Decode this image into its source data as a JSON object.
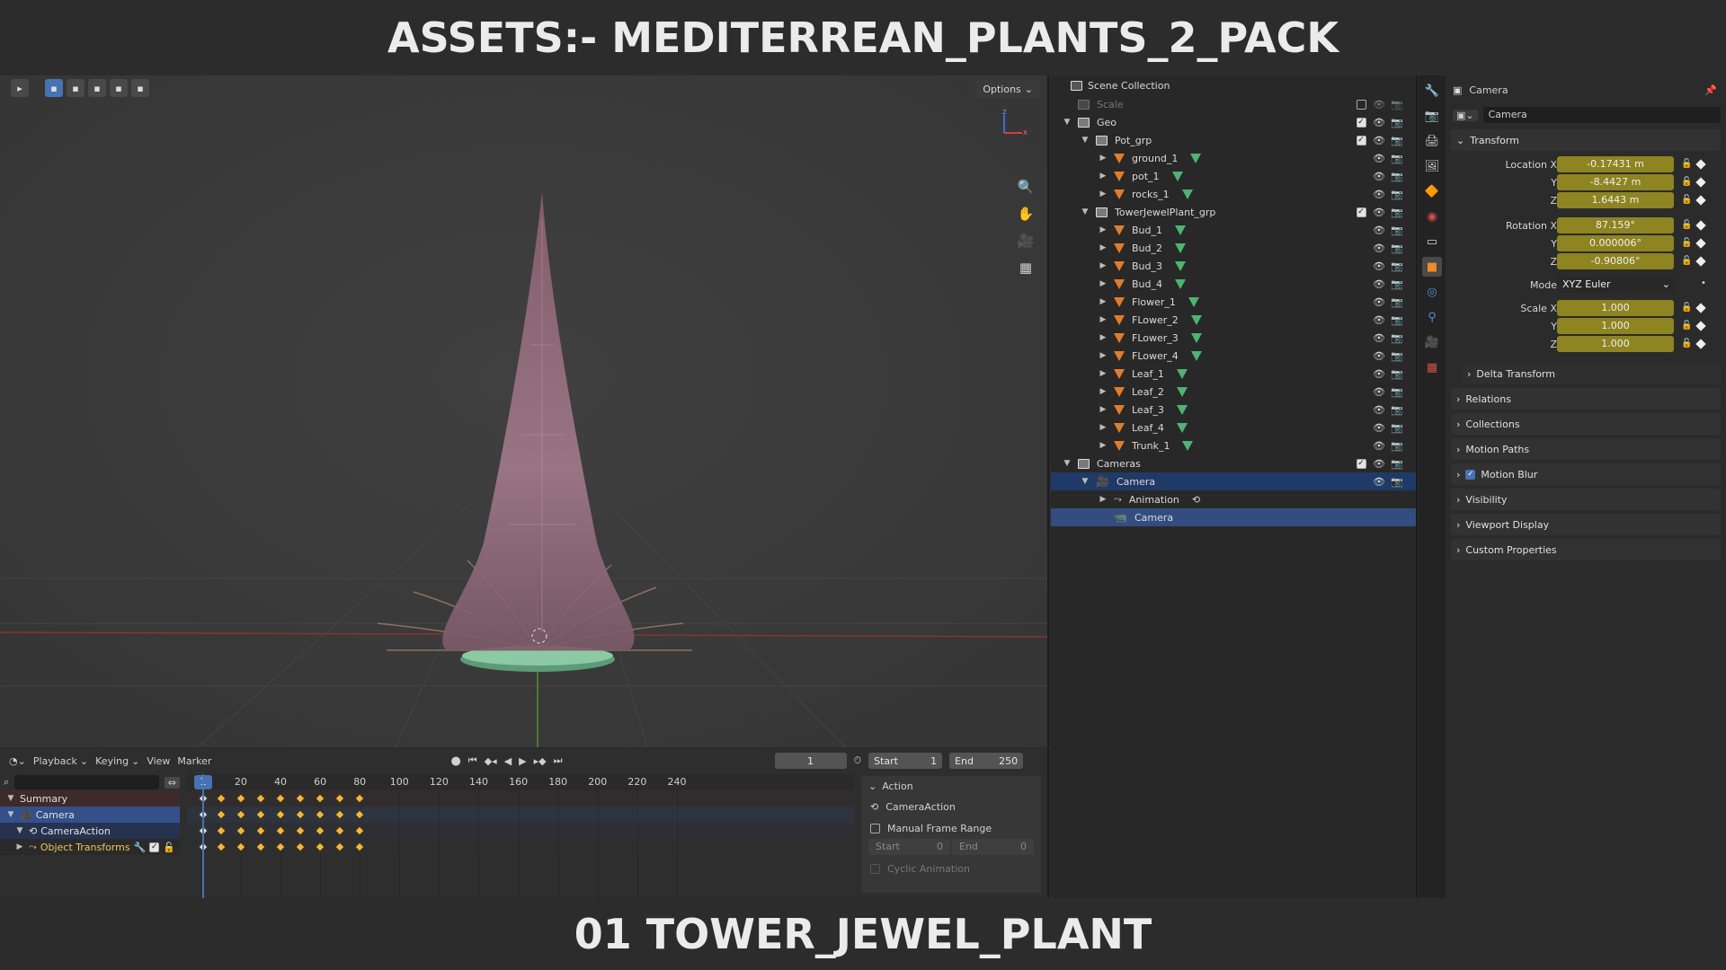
{
  "banner": {
    "top": "ASSETS:- MEDITERREAN_PLANTS_2_PACK",
    "bottom": "01 TOWER_JEWEL_PLANT"
  },
  "viewport": {
    "options_label": "Options",
    "nav_icons": [
      "zoom-icon",
      "pan-hand-icon",
      "camera-view-icon",
      "ortho-grid-icon"
    ]
  },
  "timeline": {
    "menus": [
      "Playback",
      "Keying",
      "View",
      "Marker"
    ],
    "current_frame": "1",
    "start_label": "Start",
    "start_value": "1",
    "end_label": "End",
    "end_value": "250",
    "ruler_ticks": [
      "20",
      "40",
      "60",
      "80",
      "100",
      "120",
      "140",
      "160",
      "180",
      "200",
      "220",
      "240"
    ],
    "ruler_current": "1",
    "channels": [
      "Summary",
      "Camera",
      "CameraAction",
      "Object Transforms"
    ],
    "keyframe_frames": [
      10,
      20,
      30,
      40,
      50,
      60,
      70,
      80
    ],
    "action_panel": {
      "title": "Action",
      "action_name": "CameraAction",
      "manual_range_label": "Manual Frame Range",
      "start_label": "Start",
      "start_value": "0",
      "end_label": "End",
      "end_value": "0",
      "cyclic_label": "Cyclic Animation"
    }
  },
  "outliner": {
    "root": "Scene Collection",
    "rows": [
      {
        "label": "Scale",
        "depth": 0,
        "kind": "collection",
        "dim": true,
        "check": false,
        "expanded": null
      },
      {
        "label": "Geo",
        "depth": 0,
        "kind": "collection",
        "check": true,
        "expanded": true
      },
      {
        "label": "Pot_grp",
        "depth": 1,
        "kind": "collection",
        "check": true,
        "expanded": true
      },
      {
        "label": "ground_1",
        "depth": 2,
        "kind": "mesh",
        "expanded": false
      },
      {
        "label": "pot_1",
        "depth": 2,
        "kind": "mesh",
        "expanded": false
      },
      {
        "label": "rocks_1",
        "depth": 2,
        "kind": "mesh",
        "expanded": false
      },
      {
        "label": "TowerJewelPlant_grp",
        "depth": 1,
        "kind": "collection",
        "check": true,
        "expanded": true
      },
      {
        "label": "Bud_1",
        "depth": 2,
        "kind": "mesh",
        "expanded": false
      },
      {
        "label": "Bud_2",
        "depth": 2,
        "kind": "mesh",
        "expanded": false
      },
      {
        "label": "Bud_3",
        "depth": 2,
        "kind": "mesh",
        "expanded": false
      },
      {
        "label": "Bud_4",
        "depth": 2,
        "kind": "mesh",
        "expanded": false
      },
      {
        "label": "Flower_1",
        "depth": 2,
        "kind": "mesh",
        "expanded": false
      },
      {
        "label": "FLower_2",
        "depth": 2,
        "kind": "mesh",
        "expanded": false
      },
      {
        "label": "FLower_3",
        "depth": 2,
        "kind": "mesh",
        "expanded": false
      },
      {
        "label": "FLower_4",
        "depth": 2,
        "kind": "mesh",
        "expanded": false
      },
      {
        "label": "Leaf_1",
        "depth": 2,
        "kind": "mesh",
        "expanded": false
      },
      {
        "label": "Leaf_2",
        "depth": 2,
        "kind": "mesh",
        "expanded": false
      },
      {
        "label": "Leaf_3",
        "depth": 2,
        "kind": "mesh",
        "expanded": false
      },
      {
        "label": "Leaf_4",
        "depth": 2,
        "kind": "mesh",
        "expanded": false
      },
      {
        "label": "Trunk_1",
        "depth": 2,
        "kind": "mesh",
        "expanded": false
      },
      {
        "label": "Cameras",
        "depth": 0,
        "kind": "collection",
        "check": true,
        "expanded": true
      },
      {
        "label": "Camera",
        "depth": 1,
        "kind": "camera-object",
        "expanded": true,
        "selected": true
      },
      {
        "label": "Animation",
        "depth": 2,
        "kind": "animation",
        "expanded": false
      },
      {
        "label": "Camera",
        "depth": 2,
        "kind": "camera-data",
        "active": true
      }
    ]
  },
  "properties": {
    "header_title": "Camera",
    "object_name": "Camera",
    "transform_label": "Transform",
    "location": {
      "label": "Location X",
      "x": "-0.17431 m",
      "y": "-8.4427 m",
      "z": "1.6443 m"
    },
    "rotation": {
      "label": "Rotation X",
      "x": "87.159°",
      "y": "0.000006°",
      "z": "-0.90806°"
    },
    "mode_label": "Mode",
    "mode_value": "XYZ Euler",
    "scale": {
      "label": "Scale X",
      "x": "1.000",
      "y": "1.000",
      "z": "1.000"
    },
    "axis_y": "Y",
    "axis_z": "Z",
    "delta_transform": "Delta Transform",
    "panels": [
      "Relations",
      "Collections",
      "Motion Paths",
      "Motion Blur",
      "Visibility",
      "Viewport Display",
      "Custom Properties"
    ]
  },
  "colors": {
    "accent": "#4772b3",
    "keyed_field": "#8e8421",
    "keyframe": "#f3b73b",
    "mesh_icon": "#e07d2c",
    "mesh_data_icon": "#53c27b"
  }
}
